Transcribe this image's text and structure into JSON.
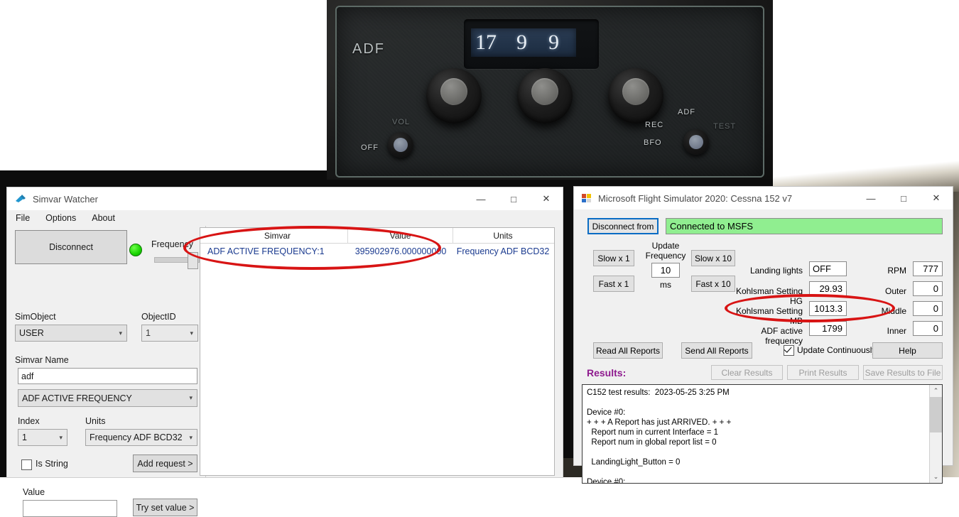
{
  "adf_panel": {
    "label": "ADF",
    "display_digits": [
      "17",
      "9",
      "9"
    ],
    "display_value": "1799",
    "vol_label": "VOL",
    "off_label": "OFF",
    "rec_label": "REC",
    "bfo_label": "BFO",
    "adf_mode_label": "ADF",
    "test_label": "TEST"
  },
  "simvar_watcher": {
    "title": "Simvar Watcher",
    "icon": "plug-icon",
    "menu": [
      "File",
      "Options",
      "About"
    ],
    "window_controls": {
      "minimize": "—",
      "maximize": "□",
      "close": "✕"
    },
    "disconnect_button": "Disconnect",
    "status_led_color": "#19d400",
    "frequency_label": "Frequency",
    "simobject_label": "SimObject",
    "simobject_value": "USER",
    "objectid_label": "ObjectID",
    "objectid_value": "1",
    "simvar_name_label": "Simvar Name",
    "simvar_name_value": "adf",
    "simvar_combo_value": "ADF ACTIVE FREQUENCY",
    "index_label": "Index",
    "index_value": "1",
    "units_label": "Units",
    "units_value": "Frequency ADF BCD32",
    "is_string_label": "Is String",
    "is_string_checked": false,
    "add_request_button": "Add request >",
    "value_label": "Value",
    "value_input": "",
    "try_set_value_button": "Try set value >",
    "table": {
      "headers": [
        "Simvar",
        "Value",
        "Units"
      ],
      "rows": [
        {
          "simvar": "ADF ACTIVE FREQUENCY:1",
          "value": "395902976.000000000",
          "units": "Frequency ADF BCD32"
        }
      ]
    }
  },
  "msfs_window": {
    "title": "Microsoft Flight Simulator 2020: Cessna 152 v7",
    "icon": "app-window-icon",
    "window_controls": {
      "minimize": "—",
      "maximize": "□",
      "close": "✕"
    },
    "disconnect_button": "Disconnect from",
    "connection_status": "Connected to MSFS",
    "connection_status_color": "#90ee90",
    "update_frequency_label_line1": "Update",
    "update_frequency_label_line2": "Frequency",
    "update_frequency_value": "10",
    "update_frequency_units": "ms",
    "speed_buttons": [
      "Slow x 1",
      "Slow x 10",
      "Fast x 1",
      "Fast x 10"
    ],
    "fields": [
      {
        "label": "Landing lights",
        "value": "OFF",
        "align": "left"
      },
      {
        "label": "Kohlsman Setting HG",
        "value": "29.93",
        "align": "right"
      },
      {
        "label": "Kohlsman Setting MB",
        "value": "1013.3",
        "align": "right"
      },
      {
        "label": "ADF active frequency",
        "value": "1799",
        "align": "right"
      }
    ],
    "right_fields": [
      {
        "label": "RPM",
        "value": "777"
      },
      {
        "label": "Outer",
        "value": "0"
      },
      {
        "label": "Middle",
        "value": "0"
      },
      {
        "label": "Inner",
        "value": "0"
      }
    ],
    "read_all_button": "Read All Reports",
    "send_all_button": "Send All Reports",
    "update_continuously_label": "Update Continuously",
    "update_continuously_checked": true,
    "help_button": "Help",
    "results_label": "Results:",
    "clear_results_button": "Clear Results",
    "print_results_button": "Print Results",
    "save_results_button": "Save Results to File",
    "results_text": "C152 test results:  2023-05-25 3:25 PM\n\nDevice #0:\n+ + + A Report has just ARRIVED. + + +\n  Report num in current Interface = 1\n  Report num in global report list = 0\n\n  LandingLight_Button = 0\n\nDevice #0:",
    "scrollbar_up": "⌃",
    "scrollbar_down": "⌄"
  },
  "annotations": {
    "color": "#d81414",
    "items": [
      "table-row-highlight",
      "adf-frequency-highlight"
    ]
  }
}
